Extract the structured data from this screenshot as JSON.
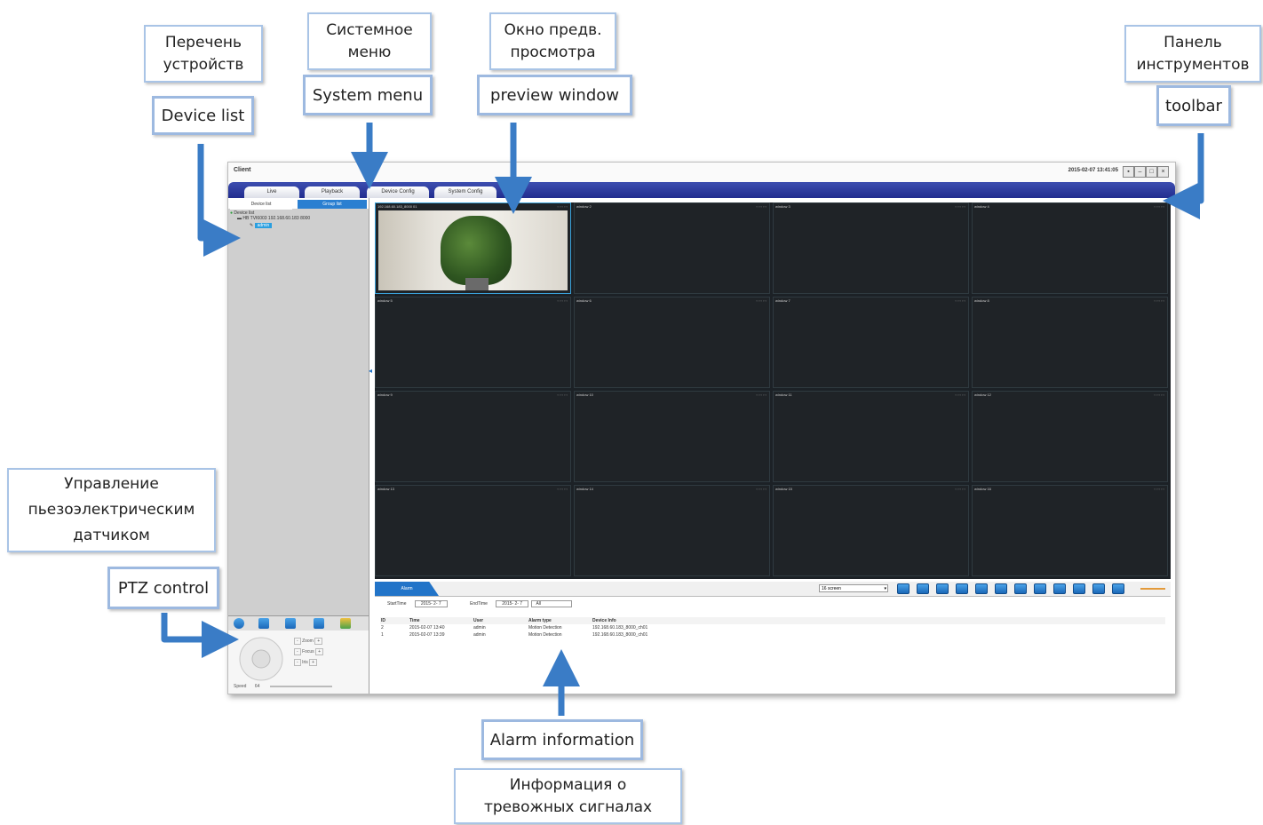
{
  "callouts": {
    "device_list_ru": "Перечень\nустройств",
    "device_list_en": "Device list",
    "system_menu_ru": "Системное\nменю",
    "system_menu_en": "System menu",
    "preview_ru": "Окно предв.\nпросмотра",
    "preview_en": "preview window",
    "toolbar_ru": "Панель\nинструментов",
    "toolbar_en": "toolbar",
    "ptz_ru": "Управление\nпьезоэлектрическим\nдатчиком",
    "ptz_en": "PTZ control",
    "alarm_en": "Alarm information",
    "alarm_ru": "Информация о\nтревожных сигналах"
  },
  "window": {
    "title": "Client",
    "clock": "2015-02-07 13:41:05"
  },
  "menu": {
    "tabs": [
      "Live",
      "Playback",
      "Device Config",
      "System Config"
    ]
  },
  "sidebar": {
    "tab_device": "Device list",
    "tab_group": "Group list",
    "tree": [
      "Device list",
      "HB TVI6003 192.168.60.183 8000",
      "admin"
    ]
  },
  "grid": {
    "labels": [
      "192.168.60.183_8000 01",
      "window 2",
      "window 3",
      "window 4",
      "window 5",
      "window 6",
      "window 7",
      "window 8",
      "window 9",
      "window 10",
      "window 11",
      "window 12",
      "window 13",
      "window 14",
      "window 15",
      "window 16"
    ]
  },
  "bottom": {
    "tab": "Alarm",
    "layout_select": "16 screen",
    "start_label": "StartTime",
    "start_value": "2015- 2- 7",
    "end_label": "EndTime",
    "end_value": "2015- 2- 7",
    "query": "All",
    "headers": [
      "ID",
      "Time",
      "User",
      "Alarm type",
      "Device Info"
    ],
    "rows": [
      [
        "2",
        "2015-02-07 13:40",
        "admin",
        "Motion Detection",
        "192.168.60.183_8000_ch01"
      ],
      [
        "1",
        "2015-02-07 13:39",
        "admin",
        "Motion Detection",
        "192.168.60.183_8000_ch01"
      ]
    ]
  },
  "ptz": {
    "zoom": "Zoom",
    "focus": "Focus",
    "iris": "Iris",
    "speed_label": "Speed",
    "speed_value": "64"
  },
  "colors": {
    "menu_blue": "#2a3697",
    "accent_blue": "#2274c8",
    "callout_border": "#a9c4e6",
    "arrow": "#3a7cc6"
  }
}
